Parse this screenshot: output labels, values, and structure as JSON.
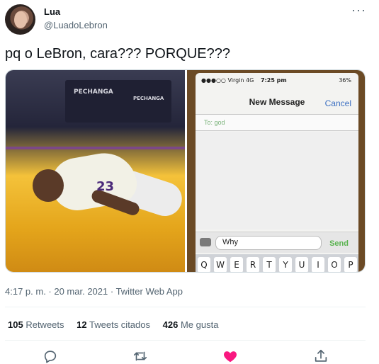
{
  "user": {
    "name": "Lua",
    "handle": "@LuadoLebron"
  },
  "tweet": {
    "text": "pq o LeBron, cara??? PORQUE???"
  },
  "media": {
    "left": {
      "sponsor_text_1": "PECHANGA",
      "sponsor_text_2": "PECHANGA",
      "jersey_number": "23"
    },
    "right": {
      "carrier": "●●●○○ Virgin  4G",
      "time": "7:25 pm",
      "battery": "36%",
      "title": "New Message",
      "cancel": "Cancel",
      "to": "To: god",
      "input_text": "Why",
      "send": "Send",
      "keys": [
        "Q",
        "W",
        "E",
        "R",
        "T",
        "Y",
        "U",
        "I",
        "O",
        "P"
      ]
    }
  },
  "meta": {
    "timestamp": "4:17 p. m. · 20 mar. 2021 · Twitter Web App"
  },
  "stats": {
    "retweets_count": "105",
    "retweets_label": "Retweets",
    "quotes_count": "12",
    "quotes_label": "Tweets citados",
    "likes_count": "426",
    "likes_label": "Me gusta"
  },
  "actions": {
    "reply_icon": "reply-icon",
    "retweet_icon": "retweet-icon",
    "like_icon": "heart-icon",
    "share_icon": "share-icon",
    "like_color": "#f91880",
    "icon_color": "#536471"
  },
  "more_icon": "···"
}
